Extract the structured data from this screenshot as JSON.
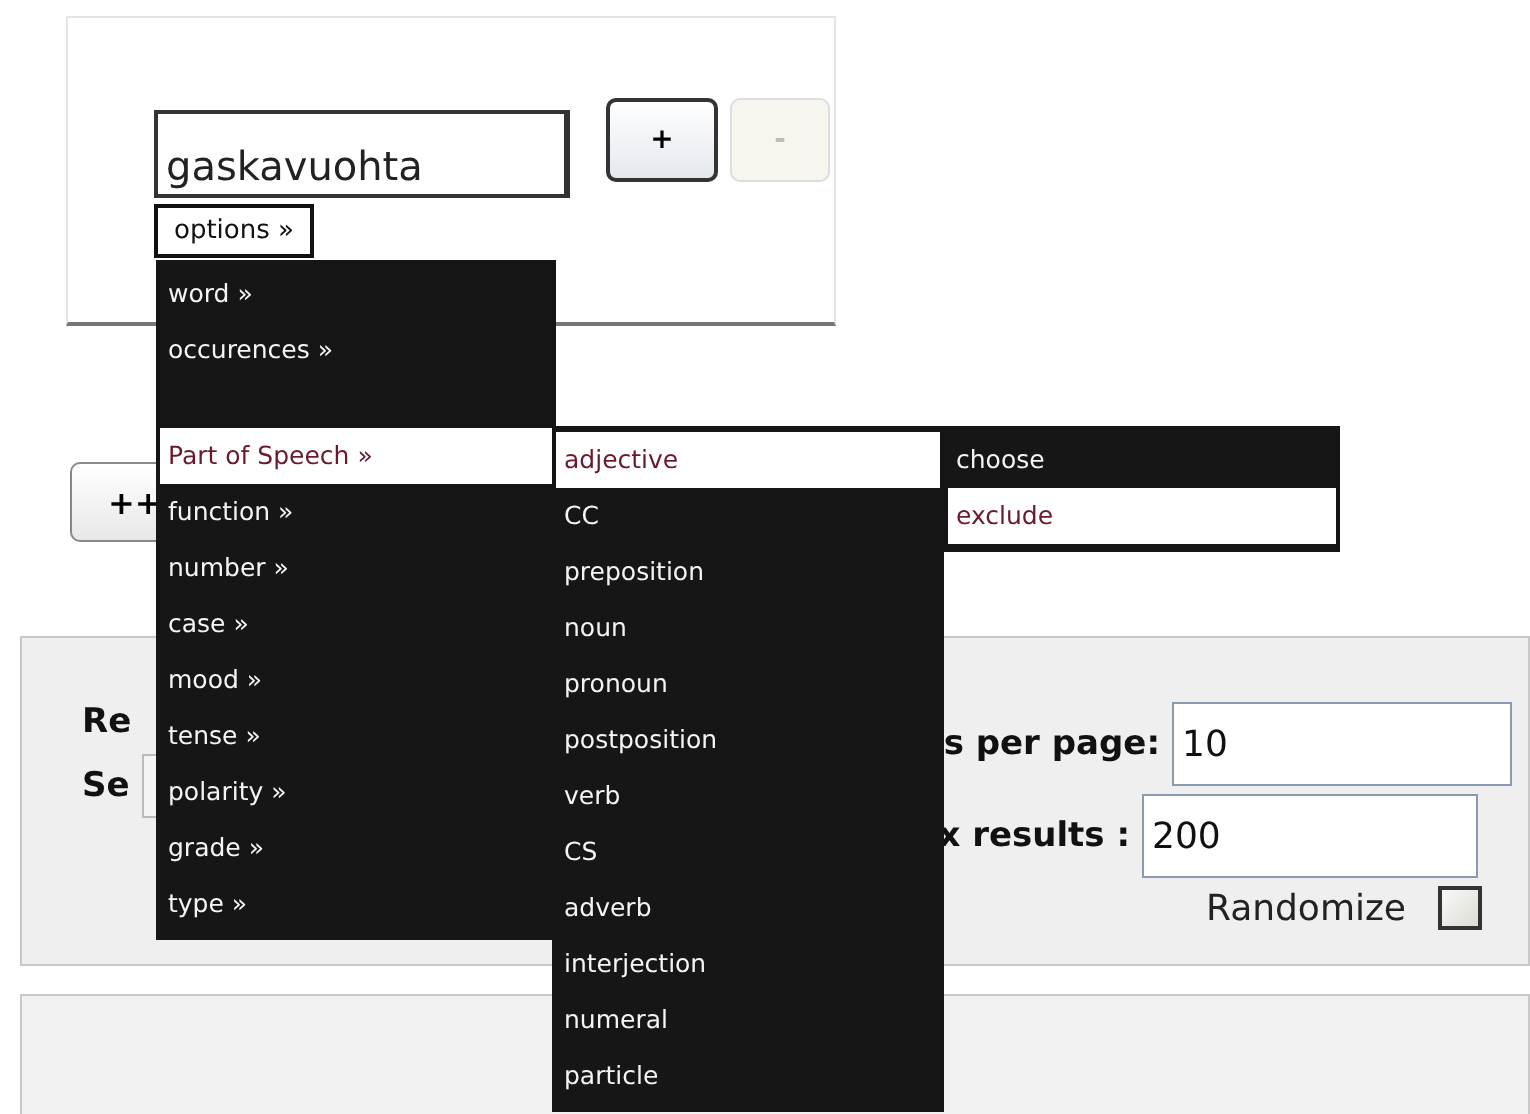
{
  "query": {
    "value": "gaskavuohta",
    "add_button": "+",
    "remove_button": "-",
    "remove_disabled": true,
    "options_button": "options »"
  },
  "add_row_button": "++",
  "menu": [
    {
      "kind": "item",
      "label": "word »",
      "selected": false
    },
    {
      "kind": "item",
      "label": "occurences »",
      "selected": false
    },
    {
      "kind": "gap"
    },
    {
      "kind": "item",
      "label": "Part of Speech »",
      "selected": true
    },
    {
      "kind": "item",
      "label": "function »",
      "selected": false
    },
    {
      "kind": "item",
      "label": "number »",
      "selected": false
    },
    {
      "kind": "item",
      "label": "case »",
      "selected": false
    },
    {
      "kind": "item",
      "label": "mood »",
      "selected": false
    },
    {
      "kind": "item",
      "label": "tense »",
      "selected": false
    },
    {
      "kind": "item",
      "label": "polarity »",
      "selected": false
    },
    {
      "kind": "item",
      "label": "grade »",
      "selected": false
    },
    {
      "kind": "item",
      "label": "type »",
      "selected": false
    }
  ],
  "submenu": [
    {
      "label": "adjective",
      "selected": true
    },
    {
      "label": "CC",
      "selected": false
    },
    {
      "label": "preposition",
      "selected": false
    },
    {
      "label": "noun",
      "selected": false
    },
    {
      "label": "pronoun",
      "selected": false
    },
    {
      "label": "postposition",
      "selected": false
    },
    {
      "label": "verb",
      "selected": false
    },
    {
      "label": "CS",
      "selected": false
    },
    {
      "label": "adverb",
      "selected": false
    },
    {
      "label": "interjection",
      "selected": false
    },
    {
      "label": "numeral",
      "selected": false
    },
    {
      "label": "particle",
      "selected": false
    }
  ],
  "action_menu": [
    {
      "label": "choose",
      "selected": false
    },
    {
      "label": "exclude",
      "selected": true
    }
  ],
  "settings": {
    "regex_label": "Re",
    "search_within_label": "Se",
    "hits_label": "s per page:",
    "hits_value": "10",
    "max_label": "x results :",
    "max_value": "200",
    "randomize_label": "Randomize",
    "randomize_checked": false
  }
}
